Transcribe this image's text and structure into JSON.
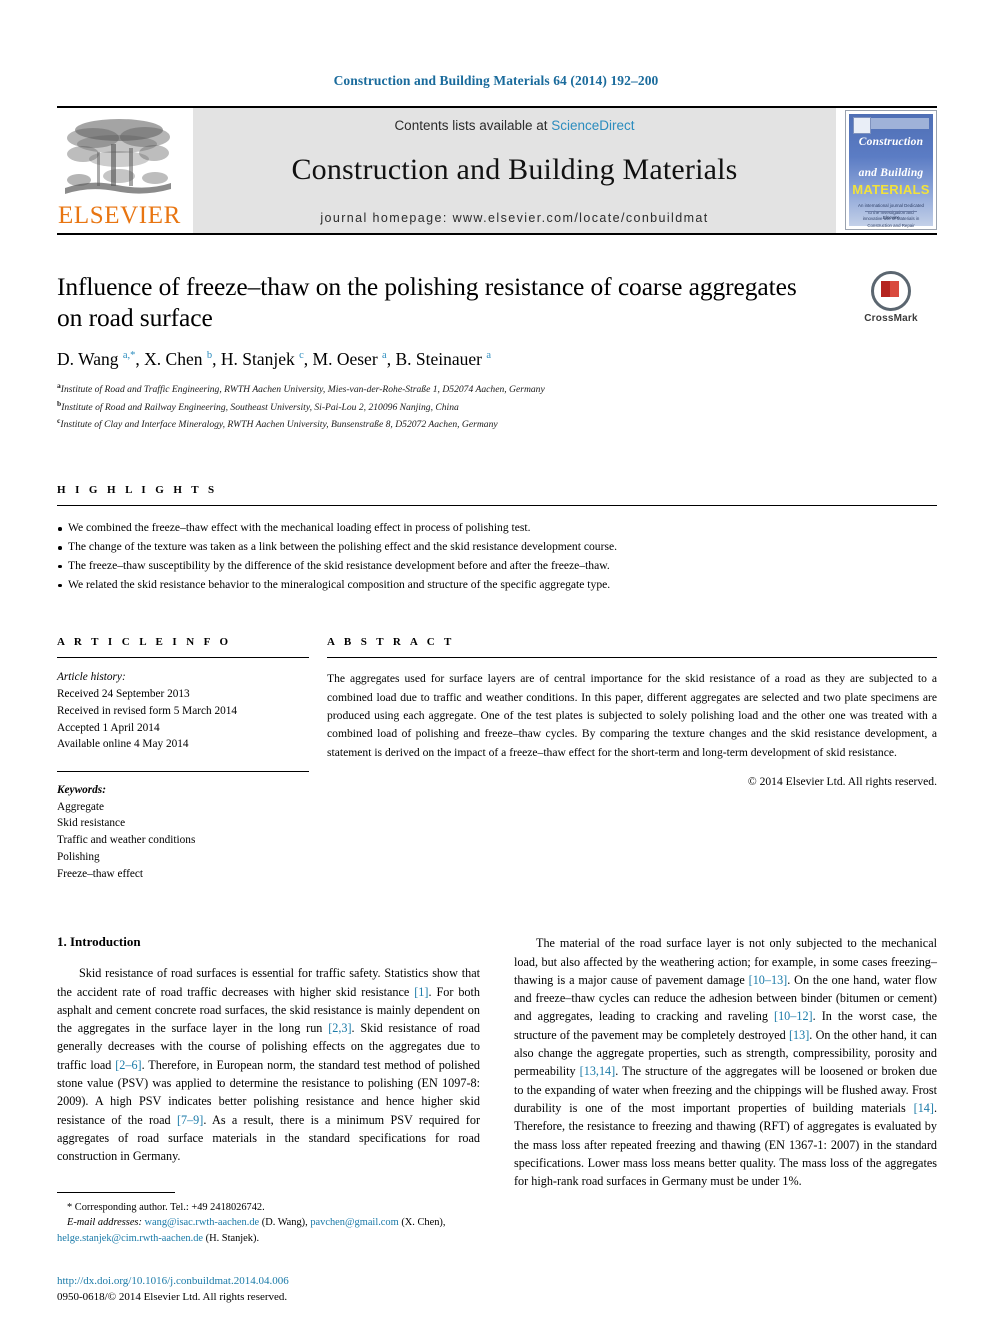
{
  "running_head": "Construction and Building Materials 64 (2014) 192–200",
  "masthead": {
    "publisher": "ELSEVIER",
    "contents_line_prefix": "Contents lists available at ",
    "sciencedirect": "ScienceDirect",
    "journal_name": "Construction and Building Materials",
    "homepage": "journal homepage: www.elsevier.com/locate/conbuildmat",
    "cover": {
      "line1": "Construction",
      "line2": "and Building",
      "line3": "MATERIALS",
      "subtitle": "An international journal Dedicated to the Investigation and innovative use of Materials in Construction and Repair",
      "footer": "Elsevier"
    },
    "colors": {
      "elsevier_orange": "#e87511",
      "link_blue": "#2b8cbe",
      "cover_blue": "#5b7cc4",
      "cover_yellow": "#f2e23b"
    }
  },
  "article": {
    "title": "Influence of freeze–thaw on the polishing resistance of coarse aggregates on road surface",
    "crossmark_label": "CrossMark",
    "authors_html": "D. Wang <sup>a,*</sup>, X. Chen <sup>b</sup>, H. Stanjek <sup>c</sup>, M. Oeser <sup>a</sup>, B. Steinauer <sup>a</sup>",
    "affiliations": [
      {
        "mark": "a",
        "text": "Institute of Road and Traffic Engineering, RWTH Aachen University, Mies-van-der-Rohe-Straße 1, D52074 Aachen, Germany"
      },
      {
        "mark": "b",
        "text": "Institute of Road and Railway Engineering, Southeast University, Si-Pai-Lou 2, 210096 Nanjing, China"
      },
      {
        "mark": "c",
        "text": "Institute of Clay and Interface Mineralogy, RWTH Aachen University, Bunsenstraße 8, D52072 Aachen, Germany"
      }
    ]
  },
  "highlights": {
    "heading": "H I G H L I G H T S",
    "items": [
      "We combined the freeze–thaw effect with the mechanical loading effect in process of polishing test.",
      "The change of the texture was taken as a link between the polishing effect and the skid resistance development course.",
      "The freeze–thaw susceptibility by the difference of the skid resistance development before and after the freeze–thaw.",
      "We related the skid resistance behavior to the mineralogical composition and structure of the specific aggregate type."
    ]
  },
  "article_info": {
    "heading": "A R T I C L E    I N F O",
    "history_label": "Article history:",
    "history": [
      "Received 24 September 2013",
      "Received in revised form 5 March 2014",
      "Accepted 1 April 2014",
      "Available online 4 May 2014"
    ],
    "keywords_label": "Keywords:",
    "keywords": [
      "Aggregate",
      "Skid resistance",
      "Traffic and weather conditions",
      "Polishing",
      "Freeze–thaw effect"
    ]
  },
  "abstract": {
    "heading": "A B S T R A C T",
    "text": "The aggregates used for surface layers are of central importance for the skid resistance of a road as they are subjected to a combined load due to traffic and weather conditions. In this paper, different aggregates are selected and two plate specimens are produced using each aggregate. One of the test plates is subjected to solely polishing load and the other one was treated with a combined load of polishing and freeze–thaw cycles. By comparing the texture changes and the skid resistance development, a statement is derived on the impact of a freeze–thaw effect for the short-term and long-term development of skid resistance.",
    "copyright": "© 2014 Elsevier Ltd. All rights reserved."
  },
  "body": {
    "section_heading": "1. Introduction",
    "left_paragraph_1": "Skid resistance of road surfaces is essential for traffic safety. Statistics show that the accident rate of road traffic decreases with higher skid resistance ",
    "left_ref_1": "[1]",
    "left_paragraph_2": ". For both asphalt and cement concrete road surfaces, the skid resistance is mainly dependent on the aggregates in the surface layer in the long run ",
    "left_ref_2": "[2,3]",
    "left_paragraph_3": ". Skid resistance of road generally decreases with the course of polishing effects on the aggregates due to traffic load ",
    "left_ref_3": "[2–6]",
    "left_paragraph_4": ". Therefore, in European norm, the standard test method of polished stone value (PSV) was applied to determine the resistance to polishing (EN 1097-8: 2009). A high PSV indicates better polishing resistance and hence higher skid resistance of the road ",
    "left_ref_4": "[7–9]",
    "left_paragraph_5": ". As a result, there is a minimum PSV required for aggregates of road surface materials in the standard specifications for road construction in Germany.",
    "right_paragraph_1": "The material of the road surface layer is not only subjected to the mechanical load, but also affected by the weathering action; for example, in some cases freezing–thawing is a major cause of pavement damage ",
    "right_ref_1": "[10–13]",
    "right_paragraph_2": ". On the one hand, water flow and freeze–thaw cycles can reduce the adhesion between binder (bitumen or cement) and aggregates, leading to cracking and raveling ",
    "right_ref_2": "[10–12]",
    "right_paragraph_3": ". In the worst case, the structure of the pavement may be completely destroyed ",
    "right_ref_3": "[13]",
    "right_paragraph_4": ". On the other hand, it can also change the aggregate properties, such as strength, compressibility, porosity and permeability ",
    "right_ref_4": "[13,14]",
    "right_paragraph_5": ". The structure of the aggregates will be loosened or broken due to the expanding of water when freezing and the chippings will be flushed away. Frost durability is one of the most important properties of building materials ",
    "right_ref_5": "[14]",
    "right_paragraph_6": ". Therefore, the resistance to freezing and thawing (RFT) of aggregates is evaluated by the mass loss after repeated freezing and thawing (EN 1367-1: 2007) in the standard specifications. Lower mass loss means better quality. The mass loss of the aggregates for high-rank road surfaces in Germany must be under 1%."
  },
  "footnote": {
    "corresponding": "* Corresponding author. Tel.: +49 2418026742.",
    "email_label": "E-mail addresses:",
    "email1": "wang@isac.rwth-aachen.de",
    "email1_name": "(D. Wang)",
    "email2": "pavchen@gmail.com",
    "email2_name": "(X. Chen)",
    "email3": "helge.stanjek@cim.rwth-aachen.de",
    "email3_name": "(H. Stanjek)",
    "separator": ", "
  },
  "footer": {
    "doi": "http://dx.doi.org/10.1016/j.conbuildmat.2014.04.006",
    "issn_copyright": "0950-0618/© 2014 Elsevier Ltd. All rights reserved."
  }
}
